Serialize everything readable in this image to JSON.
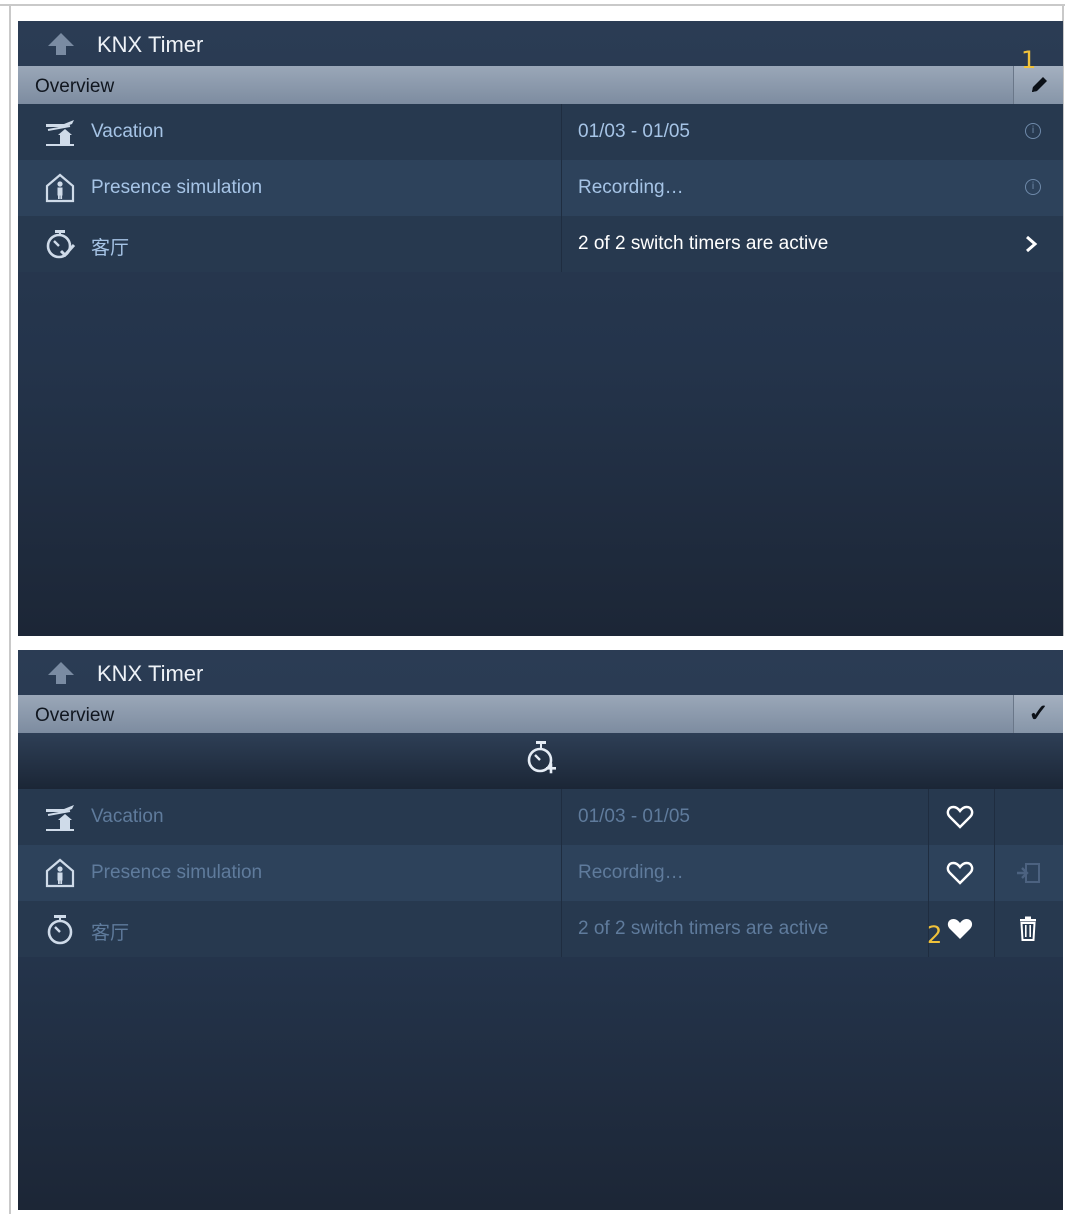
{
  "panels": [
    {
      "title": "KNX Timer",
      "overview_label": "Overview",
      "overview_action": "edit-icon",
      "callout": "1",
      "rows": [
        {
          "label": "Vacation",
          "value": "01/03 - 01/05",
          "icon": "vacation-icon",
          "end_icon": "info-icon"
        },
        {
          "label": "Presence simulation",
          "value": "Recording…",
          "icon": "presence-icon",
          "end_icon": "info-icon"
        },
        {
          "label": "客厅",
          "value": "2 of 2 switch timers are active",
          "icon": "timer-active-icon",
          "end_icon": "chevron-right-icon"
        }
      ]
    },
    {
      "title": "KNX Timer",
      "overview_label": "Overview",
      "overview_action": "confirm-icon",
      "overview_action_glyph": "✓",
      "add_button": "add-timer-icon",
      "callout": "2",
      "rows": [
        {
          "label": "Vacation",
          "value": "01/03 - 01/05",
          "icon": "vacation-icon",
          "favorite": false
        },
        {
          "label": "Presence simulation",
          "value": "Recording…",
          "icon": "presence-icon",
          "favorite": false,
          "action": "assign-icon"
        },
        {
          "label": "客厅",
          "value": "2 of 2 switch timers are active",
          "icon": "timer-icon",
          "favorite": true,
          "action": "delete-icon"
        }
      ]
    }
  ],
  "colors": {
    "accent_callout": "#f0c23a",
    "row_text": "#a6c4e6",
    "row_text_faded": "#5f7b9c",
    "overview_bar": "#8a98aa"
  }
}
